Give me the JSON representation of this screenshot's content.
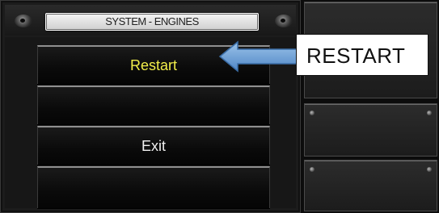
{
  "title_bar": {
    "title": "SYSTEM - ENGINES"
  },
  "menu": {
    "restart_label": "Restart",
    "blank_1_label": "",
    "exit_label": "Exit",
    "blank_2_label": ""
  },
  "annotation": {
    "callout_text": "RESTART",
    "arrow_color": "#6fa8dc"
  },
  "colors": {
    "restart_text": "#f2ee4a",
    "exit_text": "#f0f0f0",
    "title_plate": "#e6e6e6"
  },
  "icons": [
    "bolt-icon",
    "bolt-icon",
    "screw-icon"
  ]
}
